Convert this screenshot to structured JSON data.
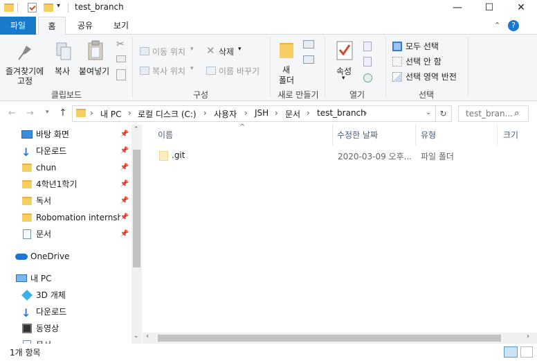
{
  "window": {
    "title": "test_branch",
    "controls": {
      "minimize": "—",
      "maximize": "☐",
      "close": "✕"
    }
  },
  "ribbon_tabs": [
    "파일",
    "홈",
    "공유",
    "보기"
  ],
  "ribbon": {
    "clipboard": {
      "pin_label_line1": "즐겨찾기에",
      "pin_label_line2": "고정",
      "copy": "복사",
      "paste": "붙여넣기",
      "group": "클립보드"
    },
    "organize": {
      "move_to": "이동 위치",
      "copy_to": "복사 위치",
      "delete": "삭제",
      "rename": "이름 바꾸기",
      "group": "구성"
    },
    "new": {
      "new_folder_line1": "새",
      "new_folder_line2": "폴더",
      "group": "새로 만들기"
    },
    "open": {
      "properties": "속성",
      "group": "열기"
    },
    "select": {
      "select_all": "모두 선택",
      "select_none": "선택 안 함",
      "invert": "선택 영역 반전",
      "group": "선택"
    }
  },
  "address": {
    "segments": [
      "내 PC",
      "로컬 디스크 (C:)",
      "사용자",
      "JSH",
      "문서",
      "test_branch"
    ],
    "search_placeholder": "test_bran..."
  },
  "nav": {
    "quick_access": [
      {
        "label": "바탕 화면",
        "icon": "desktop-icon",
        "pinned": true
      },
      {
        "label": "다운로드",
        "icon": "download-icon",
        "pinned": true
      },
      {
        "label": "chun",
        "icon": "folder-icon",
        "pinned": true
      },
      {
        "label": "4학년1학기",
        "icon": "folder-icon",
        "pinned": true
      },
      {
        "label": "독서",
        "icon": "folder-icon",
        "pinned": true
      },
      {
        "label": "Robomation internship",
        "icon": "folder-icon",
        "pinned": true
      },
      {
        "label": "문서",
        "icon": "document-icon",
        "pinned": true
      }
    ],
    "onedrive": "OneDrive",
    "this_pc": "내 PC",
    "pc_items": [
      {
        "label": "3D 개체",
        "icon": "3d-objects-icon"
      },
      {
        "label": "다운로드",
        "icon": "download-icon"
      },
      {
        "label": "동영상",
        "icon": "video-icon"
      },
      {
        "label": "문서",
        "icon": "document-icon"
      }
    ]
  },
  "file_list": {
    "columns": [
      "이름",
      "수정한 날짜",
      "유형",
      "크기"
    ],
    "rows": [
      {
        "name": ".git",
        "modified": "2020-03-09 오후...",
        "type": "파일 폴더",
        "size": ""
      }
    ]
  },
  "status": {
    "count": "1개 항목"
  },
  "colors": {
    "file_tab": "#1979ca",
    "folder": "#f5cf63",
    "accent": "#1979ca"
  }
}
